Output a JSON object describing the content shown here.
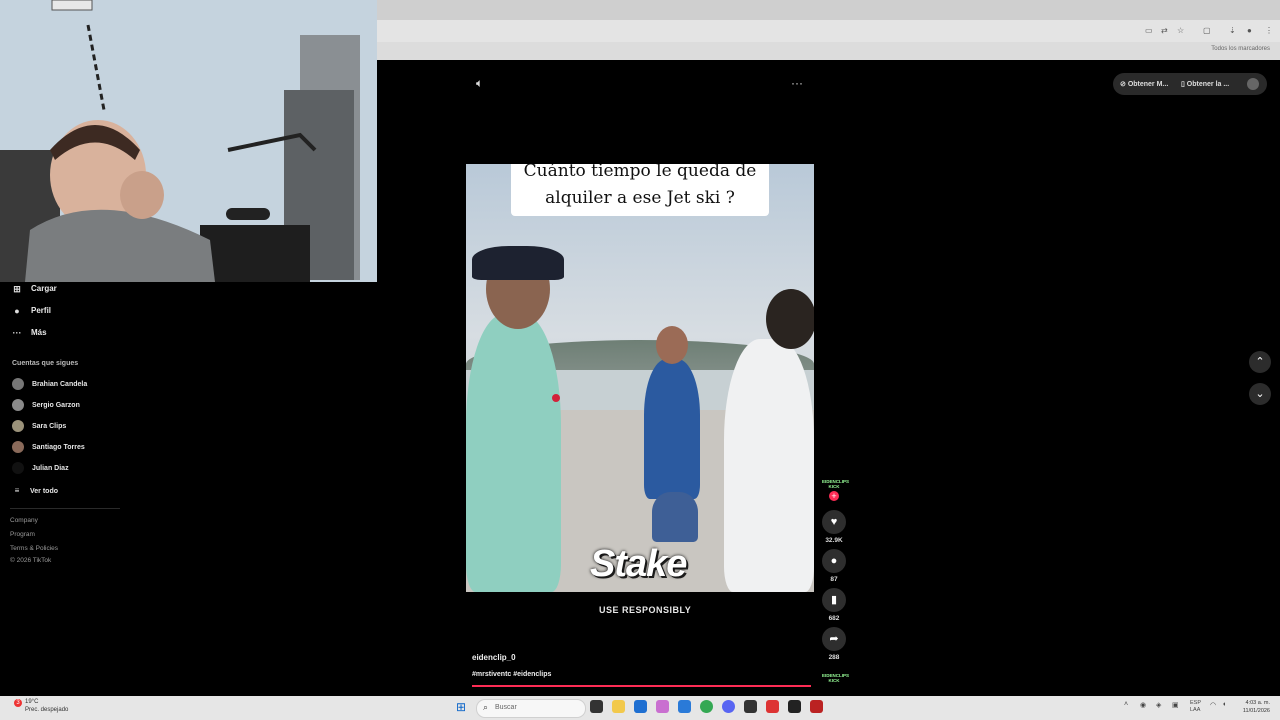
{
  "browser": {
    "bookmarks_label": "Todos los marcadores"
  },
  "sidebar": {
    "items": [
      {
        "label": "Cargar",
        "icon": "upload-icon"
      },
      {
        "label": "Perfil",
        "icon": "profile-icon"
      },
      {
        "label": "Más",
        "icon": "more-icon"
      }
    ],
    "following_heading": "Cuentas que sigues",
    "following": [
      {
        "name": "Brahian Candela"
      },
      {
        "name": "Sergio Garzon"
      },
      {
        "name": "Sara Clips"
      },
      {
        "name": "Santiago Torres"
      },
      {
        "name": "Julian Diaz"
      }
    ],
    "see_all": "Ver todo",
    "footer": [
      "Company",
      "Program",
      "Terms & Policies",
      "© 2026 TikTok"
    ]
  },
  "video": {
    "caption_line1": "Cuánto tiempo le queda de",
    "caption_line2": "alquiler a ese Jet ski ?",
    "watermark": "Stake",
    "watermark_sub": "USE RESPONSIBLY",
    "author": "eidenclip_0",
    "hashtags": "#mrstiventc #eidenclips",
    "author_badge": "EIDENCLIPS KICK"
  },
  "actions": {
    "likes": "32.9K",
    "comments": "87",
    "saves": "682",
    "shares": "288"
  },
  "get_app": {
    "desktop_label": "Obtener M...",
    "mobile_label": "Obtener la ..."
  },
  "taskbar": {
    "weather_temp": "19°C",
    "weather_desc": "Prec. despejado",
    "notification_count": "3",
    "search_placeholder": "Buscar",
    "lang": "ESP",
    "region": "LAA",
    "time": "4:03 a. m.",
    "date": "11/01/2026"
  },
  "colors": {
    "accent": "#fe2c55",
    "background": "#000000"
  }
}
